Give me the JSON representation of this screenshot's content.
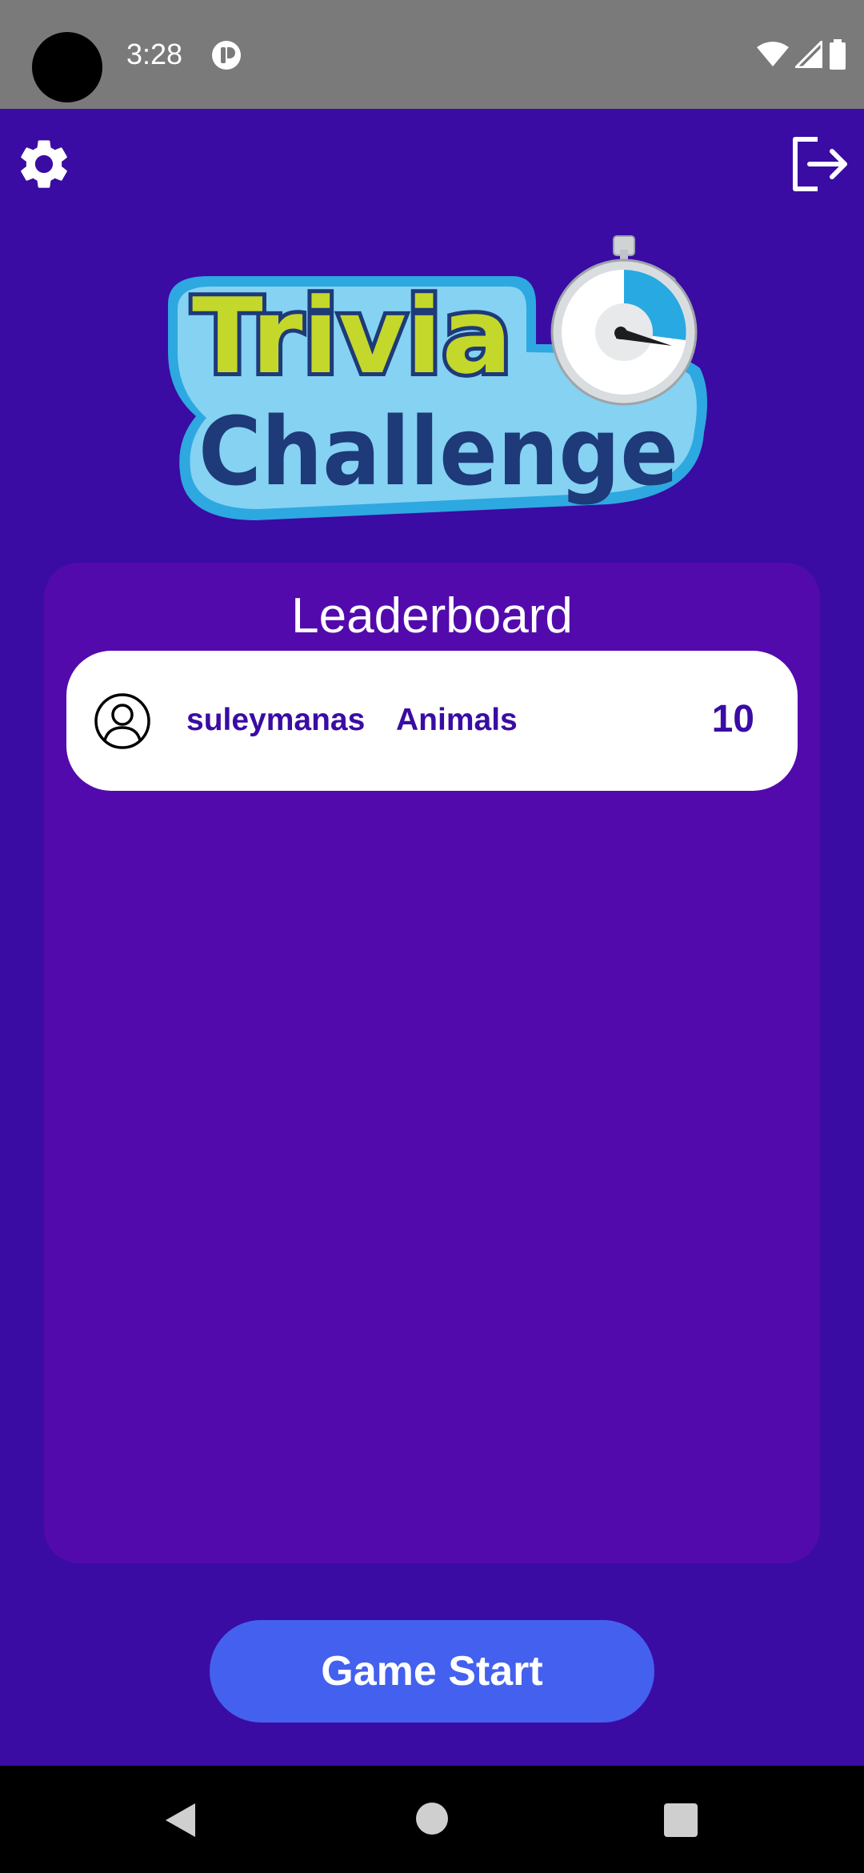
{
  "status_bar": {
    "time": "3:28",
    "icons": [
      "app-notification-icon",
      "wifi-icon",
      "signal-icon",
      "battery-icon"
    ]
  },
  "toolbar": {
    "settings_icon": "gear-icon",
    "logout_icon": "logout-icon"
  },
  "logo": {
    "line1": "Trivia",
    "line2": "Challenge"
  },
  "leaderboard": {
    "title": "Leaderboard",
    "entries": [
      {
        "username": "suleymanas",
        "category": "Animals",
        "score": "10",
        "avatar_icon": "user-avatar-icon"
      }
    ]
  },
  "actions": {
    "game_start_label": "Game Start"
  },
  "navigation": {
    "icons": [
      "back-icon",
      "home-icon",
      "recents-icon"
    ]
  },
  "colors": {
    "background": "#3a0ca3",
    "panel": "#530aad",
    "accent_button": "#4361ee",
    "row_text": "#3a0ca3",
    "logo_green": "#c4d72b",
    "logo_blue": "#1e3a78",
    "logo_outline": "#2ea8e0"
  }
}
